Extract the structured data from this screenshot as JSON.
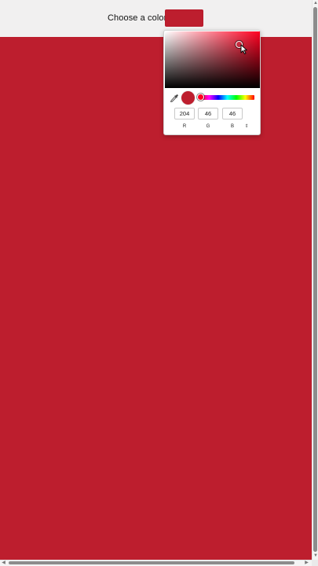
{
  "header": {
    "label": "Choose a color:"
  },
  "colors": {
    "selected": "#bd1e2e",
    "swatch": "#bd1e2e",
    "hue_base": "#ff0020",
    "topbar_bg": "#f1f0f0"
  },
  "picker": {
    "mode": "RGB",
    "rgb": {
      "r": "204",
      "g": "46",
      "b": "46"
    },
    "labels": {
      "r": "R",
      "g": "G",
      "b": "B"
    },
    "mode_toggle_icon": "up-down-arrows-icon",
    "eyedropper_icon": "eyedropper-icon",
    "hue_position": 0.0
  },
  "scrollbars": {
    "up_icon": "▲",
    "down_icon": "▼",
    "left_icon": "◀",
    "right_icon": "▶"
  }
}
